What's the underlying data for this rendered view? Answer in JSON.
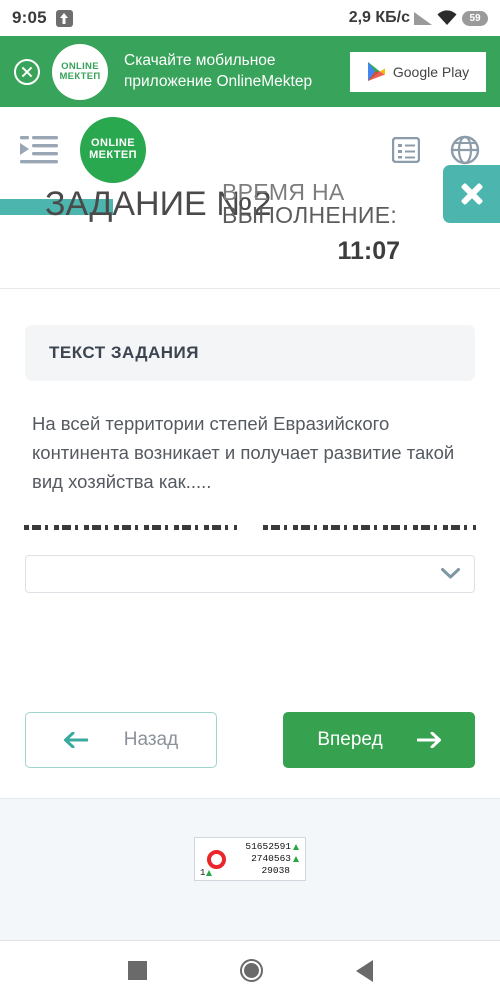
{
  "statusbar": {
    "time": "9:05",
    "upload_icon": "upload-icon",
    "network_speed": "2,9 КБ/с",
    "signal_icon": "signal-icon",
    "wifi_icon": "wifi-icon",
    "battery": "59"
  },
  "promo": {
    "close_icon": "close-circle-icon",
    "logo_line1": "ONLINE",
    "logo_line2": "МЕКТЕП",
    "text": "Скачайте мобильное приложение OnlineMektep",
    "store_button": "Google Play",
    "store_icon": "google-play-icon",
    "background": "#38a35a"
  },
  "appbar": {
    "menu_icon": "menu-indent-icon",
    "logo_line1": "ONLINE",
    "logo_line2": "МЕКТЕП",
    "logo_color": "#2aa84f",
    "list_icon": "list-icon",
    "globe_icon": "globe-icon",
    "close_overlay_icon": "close-icon",
    "close_overlay_color": "#4cb5ad"
  },
  "task": {
    "title": "ЗАДАНИЕ №2",
    "timer_label_line1": "ВРЕМЯ НА",
    "timer_label_line2": "ВЫПОЛНЕНИЕ:",
    "timer_value": "11:07",
    "section_header": "ТЕКСТ ЗАДАНИЯ",
    "question": "На всей территории степей Евразийского континента возникает и получает развитие такой вид хозяйства как.....",
    "answer_select_value": "",
    "answer_select_chevron": "chevron-down-icon"
  },
  "navigation": {
    "back_label": "Назад",
    "back_icon": "arrow-left-icon",
    "next_label": "Вперед",
    "next_icon": "arrow-right-icon",
    "next_color": "#36a24f"
  },
  "counter": {
    "logo_icon": "red-ring-icon",
    "rank": "1",
    "rank_trend_icon": "triangle-up-icon",
    "row1": "51652591",
    "row1_trend_icon": "triangle-up-icon",
    "row2": "2740563",
    "row2_trend_icon": "triangle-up-icon",
    "row3": "29038"
  },
  "androidnav": {
    "recents_icon": "square-recents-icon",
    "home_icon": "circle-home-icon",
    "back_icon": "triangle-back-icon"
  }
}
